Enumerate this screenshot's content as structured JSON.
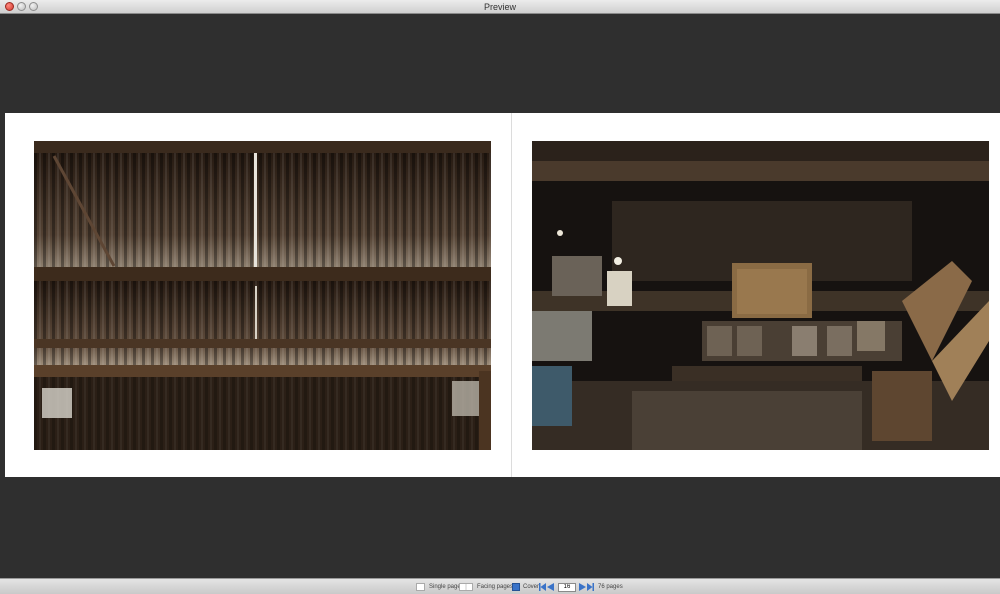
{
  "window": {
    "title": "Preview"
  },
  "toolbar": {
    "single_label": "Single page",
    "facing_label": "Facing pages",
    "cover_label": "Cover",
    "page_value": "16",
    "page_count_label": "76 pages"
  },
  "colors": {
    "accent": "#3a73c8"
  }
}
